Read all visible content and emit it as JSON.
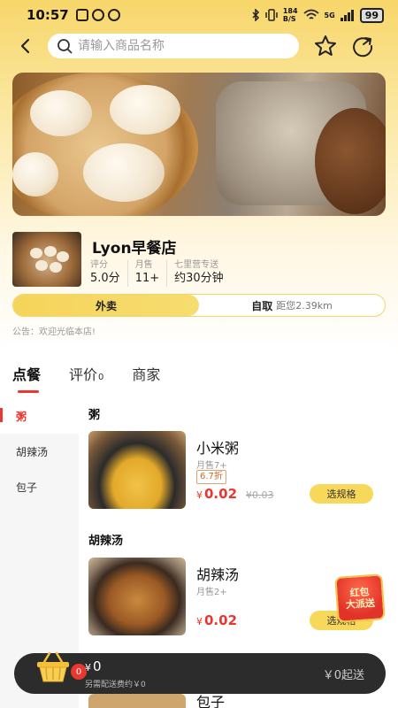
{
  "status_bar": {
    "time": "10:57",
    "speed_top": "184",
    "speed_bottom": "B/S",
    "network": "5G",
    "battery": "99"
  },
  "search": {
    "placeholder": "请输入商品名称"
  },
  "store": {
    "name": "Lyon早餐店",
    "stats": [
      {
        "label": "评分",
        "value": "5.0分"
      },
      {
        "label": "月售",
        "value": "11+"
      },
      {
        "label": "七里营专送",
        "value": "约30分钟"
      }
    ],
    "delivery_label": "外卖",
    "pickup_label": "自取",
    "pickup_distance": "距您2.39km",
    "notice": "公告：欢迎光临本店!"
  },
  "tabs": [
    {
      "label": "点餐"
    },
    {
      "label": "评价",
      "count": "0"
    },
    {
      "label": "商家"
    }
  ],
  "categories": [
    "粥",
    "胡辣汤",
    "包子"
  ],
  "sections": [
    {
      "title": "粥",
      "product": {
        "name": "小米粥",
        "sold": "月售7+",
        "discount": "6.7折",
        "currency": "¥",
        "price": "0.02",
        "original_price": "¥0.03",
        "button": "选规格"
      }
    },
    {
      "title": "胡辣汤",
      "product": {
        "name": "胡辣汤",
        "sold": "月售2+",
        "currency": "¥",
        "price": "0.02",
        "button": "选规格"
      }
    }
  ],
  "peek_product": {
    "name": "包子"
  },
  "red_packet": {
    "line1": "红包",
    "line2": "大派送"
  },
  "cart": {
    "badge": "0",
    "currency": "¥",
    "total": "0",
    "fee_text": "另需配送费约￥0",
    "min_order": "￥0起送"
  },
  "colors": {
    "accent": "#f8d85b",
    "price_red": "#e8382f",
    "cart_bg": "#2c2c2c"
  }
}
